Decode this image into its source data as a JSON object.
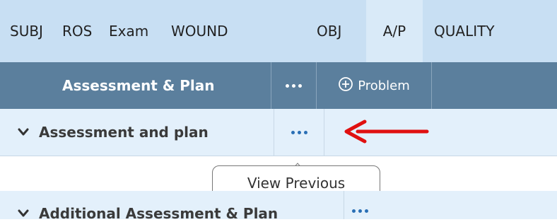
{
  "tabs": [
    {
      "label": "SUBJ",
      "active": false
    },
    {
      "label": "ROS",
      "active": false
    },
    {
      "label": "Exam",
      "active": false
    },
    {
      "label": "WOUND",
      "active": false
    },
    {
      "label": "OBJ",
      "active": false
    },
    {
      "label": "A/P",
      "active": true
    },
    {
      "label": "QUALITY",
      "active": false
    }
  ],
  "toolbar": {
    "title": "Assessment & Plan",
    "back_icon": "arrow-left-icon",
    "more_icon": "ellipsis-icon",
    "problem_label": "Problem",
    "problem_icon": "plus-circle-icon"
  },
  "section": {
    "title": "Assessment and plan",
    "chevron_icon": "chevron-down-icon",
    "more_icon": "ellipsis-icon"
  },
  "tooltip": {
    "text": "View Previous"
  },
  "section2": {
    "title": "Additional Assessment & Plan",
    "chevron_icon": "chevron-down-icon",
    "more_icon": "ellipsis-icon"
  },
  "colors": {
    "tabbar_bg": "#c8dff3",
    "toolbar_bg": "#5b7f9d",
    "section_bg": "#e3f0fb",
    "accent_blue": "#2a6fb5",
    "annotation_arrow": "#e01010"
  }
}
